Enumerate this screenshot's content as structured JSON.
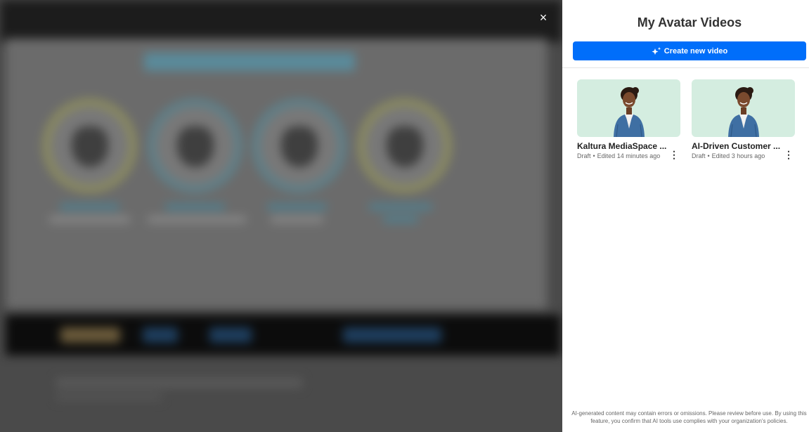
{
  "overlay": {
    "close_label": "×"
  },
  "panel": {
    "title": "My Avatar Videos",
    "create_button_label": "Create new video",
    "create_button_icon": "sparkles-icon",
    "accent_color": "#006efa",
    "videos": [
      {
        "title": "Kaltura MediaSpace ...",
        "status": "Draft",
        "edited": "Edited 14 minutes ago",
        "thumbnail_icon": "avatar-thumbnail"
      },
      {
        "title": "AI-Driven Customer ...",
        "status": "Draft",
        "edited": "Edited 3 hours ago",
        "thumbnail_icon": "avatar-thumbnail"
      }
    ],
    "more_options_label": "⋮",
    "status_separator": "•",
    "disclaimer": "AI-generated content may contain errors or omissions. Please review before use. By using this feature, you confirm that AI tools use complies with your organization's policies."
  }
}
